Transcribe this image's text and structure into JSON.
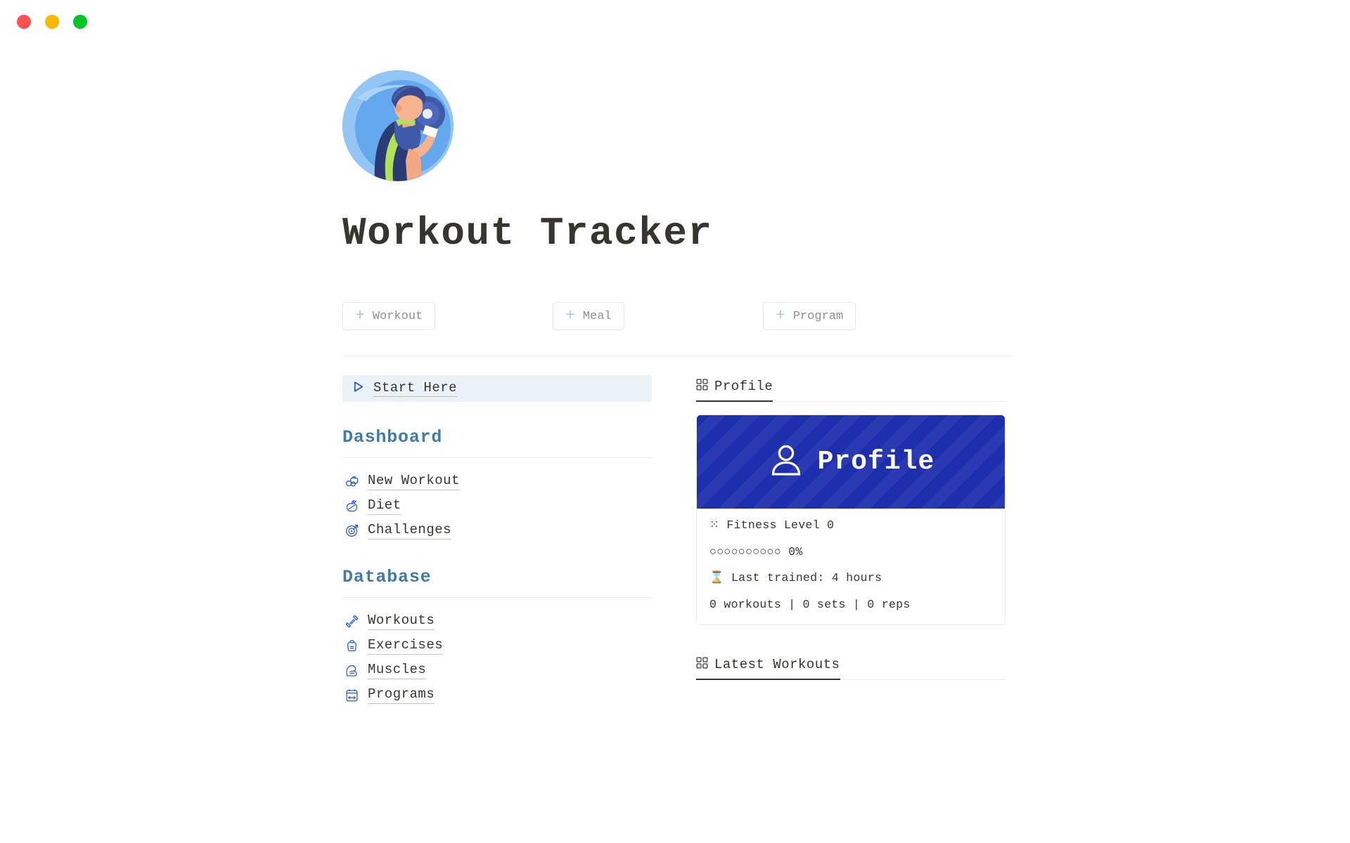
{
  "window": {
    "controls": [
      {
        "name": "close",
        "color": "#fe4f51"
      },
      {
        "name": "minimize",
        "color": "#ffb700"
      },
      {
        "name": "zoom",
        "color": "#00c627"
      }
    ]
  },
  "header": {
    "icon": "weightlifter-avatar-icon",
    "title": "Workout Tracker"
  },
  "quick_actions": [
    {
      "icon": "plus-icon",
      "label": "Workout"
    },
    {
      "icon": "plus-icon",
      "label": "Meal"
    },
    {
      "icon": "plus-icon",
      "label": "Program"
    }
  ],
  "sidebar": {
    "start_here": {
      "icon": "play-triangle-icon",
      "label": "Start Here"
    },
    "sections": [
      {
        "heading": "Dashboard",
        "items": [
          {
            "icon": "kettlebell-dumbbell-icon",
            "label": "New Workout"
          },
          {
            "icon": "apple-diet-icon",
            "label": "Diet"
          },
          {
            "icon": "target-bullseye-icon",
            "label": "Challenges"
          }
        ]
      },
      {
        "heading": "Database",
        "items": [
          {
            "icon": "dumbbell-icon",
            "label": "Workouts"
          },
          {
            "icon": "kettlebell-icon",
            "label": "Exercises"
          },
          {
            "icon": "flexed-bicep-icon",
            "label": "Muscles"
          },
          {
            "icon": "calendar-weight-icon",
            "label": "Programs"
          }
        ]
      }
    ]
  },
  "main": {
    "tabs": [
      {
        "icon": "grid-gallery-icon",
        "label": "Profile",
        "active": true
      },
      {
        "icon": "grid-gallery-icon",
        "label": "Latest Workouts",
        "active": true
      }
    ],
    "profile_card": {
      "banner": {
        "icon": "person-silhouette-icon",
        "label": "Profile",
        "background_color": "#1e2fae",
        "pattern": "diagonal-stripes"
      },
      "lines": [
        "⁙ Fitness Level 0",
        "○○○○○○○○○○ 0%",
        "⌛ Last trained: 4 hours",
        "0 workouts | 0 sets | 0 reps"
      ],
      "fitness_level": 0,
      "progress_percent": "0%",
      "progress_filled": 0,
      "progress_total": 10,
      "last_trained": "4 hours",
      "workouts": 0,
      "sets": 0,
      "reps": 0
    }
  },
  "colors": {
    "accent_blue": "#1e2fae",
    "section_heading": "#417ba8",
    "text": "#37352f",
    "icon_blue": "#2b5fd9",
    "plus_blue": "#a7c9e8",
    "highlight_bg": "#eaf1f7"
  }
}
